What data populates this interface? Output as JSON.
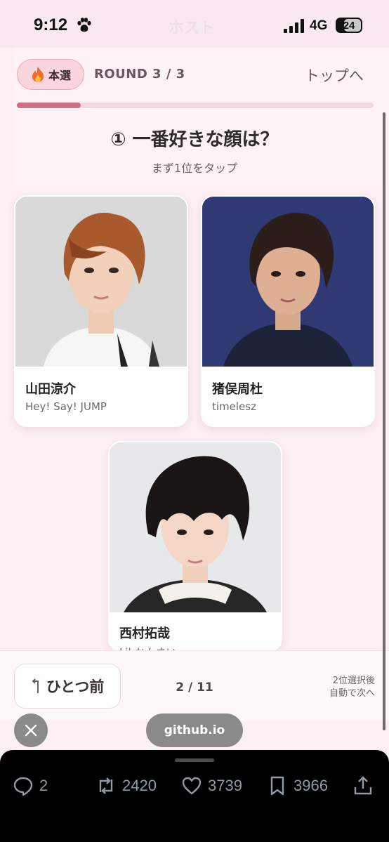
{
  "status_bar": {
    "time": "9:12",
    "network": "4G",
    "battery": "24",
    "ghost_title": "ホスト"
  },
  "header": {
    "badge_label": "本選",
    "round_label": "ROUND 3 / 3",
    "top_link": "トップへ",
    "progress_fraction": 0.18
  },
  "question": {
    "title": "① 一番好きな顔は？",
    "hint": "まず1位をタップ"
  },
  "candidates": [
    {
      "name": "山田涼介",
      "group": "Hey! Say! JUMP"
    },
    {
      "name": "猪俣周杜",
      "group": "timelesz"
    },
    {
      "name": "西村拓哉",
      "group": "Lil かんさい"
    }
  ],
  "bottom_bar": {
    "back_label": "ひとつ前",
    "counter": "2 / 11",
    "auto_next_line1": "2位選択後",
    "auto_next_line2": "自動で次へ"
  },
  "browser": {
    "url": "github.io"
  },
  "tweet_actions": {
    "replies": "2",
    "retweets": "2420",
    "likes": "3739",
    "bookmarks": "3966"
  },
  "colors": {
    "accent": "#cf6f87",
    "badge_bg": "#fbd5dd",
    "page_bg": "#fdf0f5"
  }
}
